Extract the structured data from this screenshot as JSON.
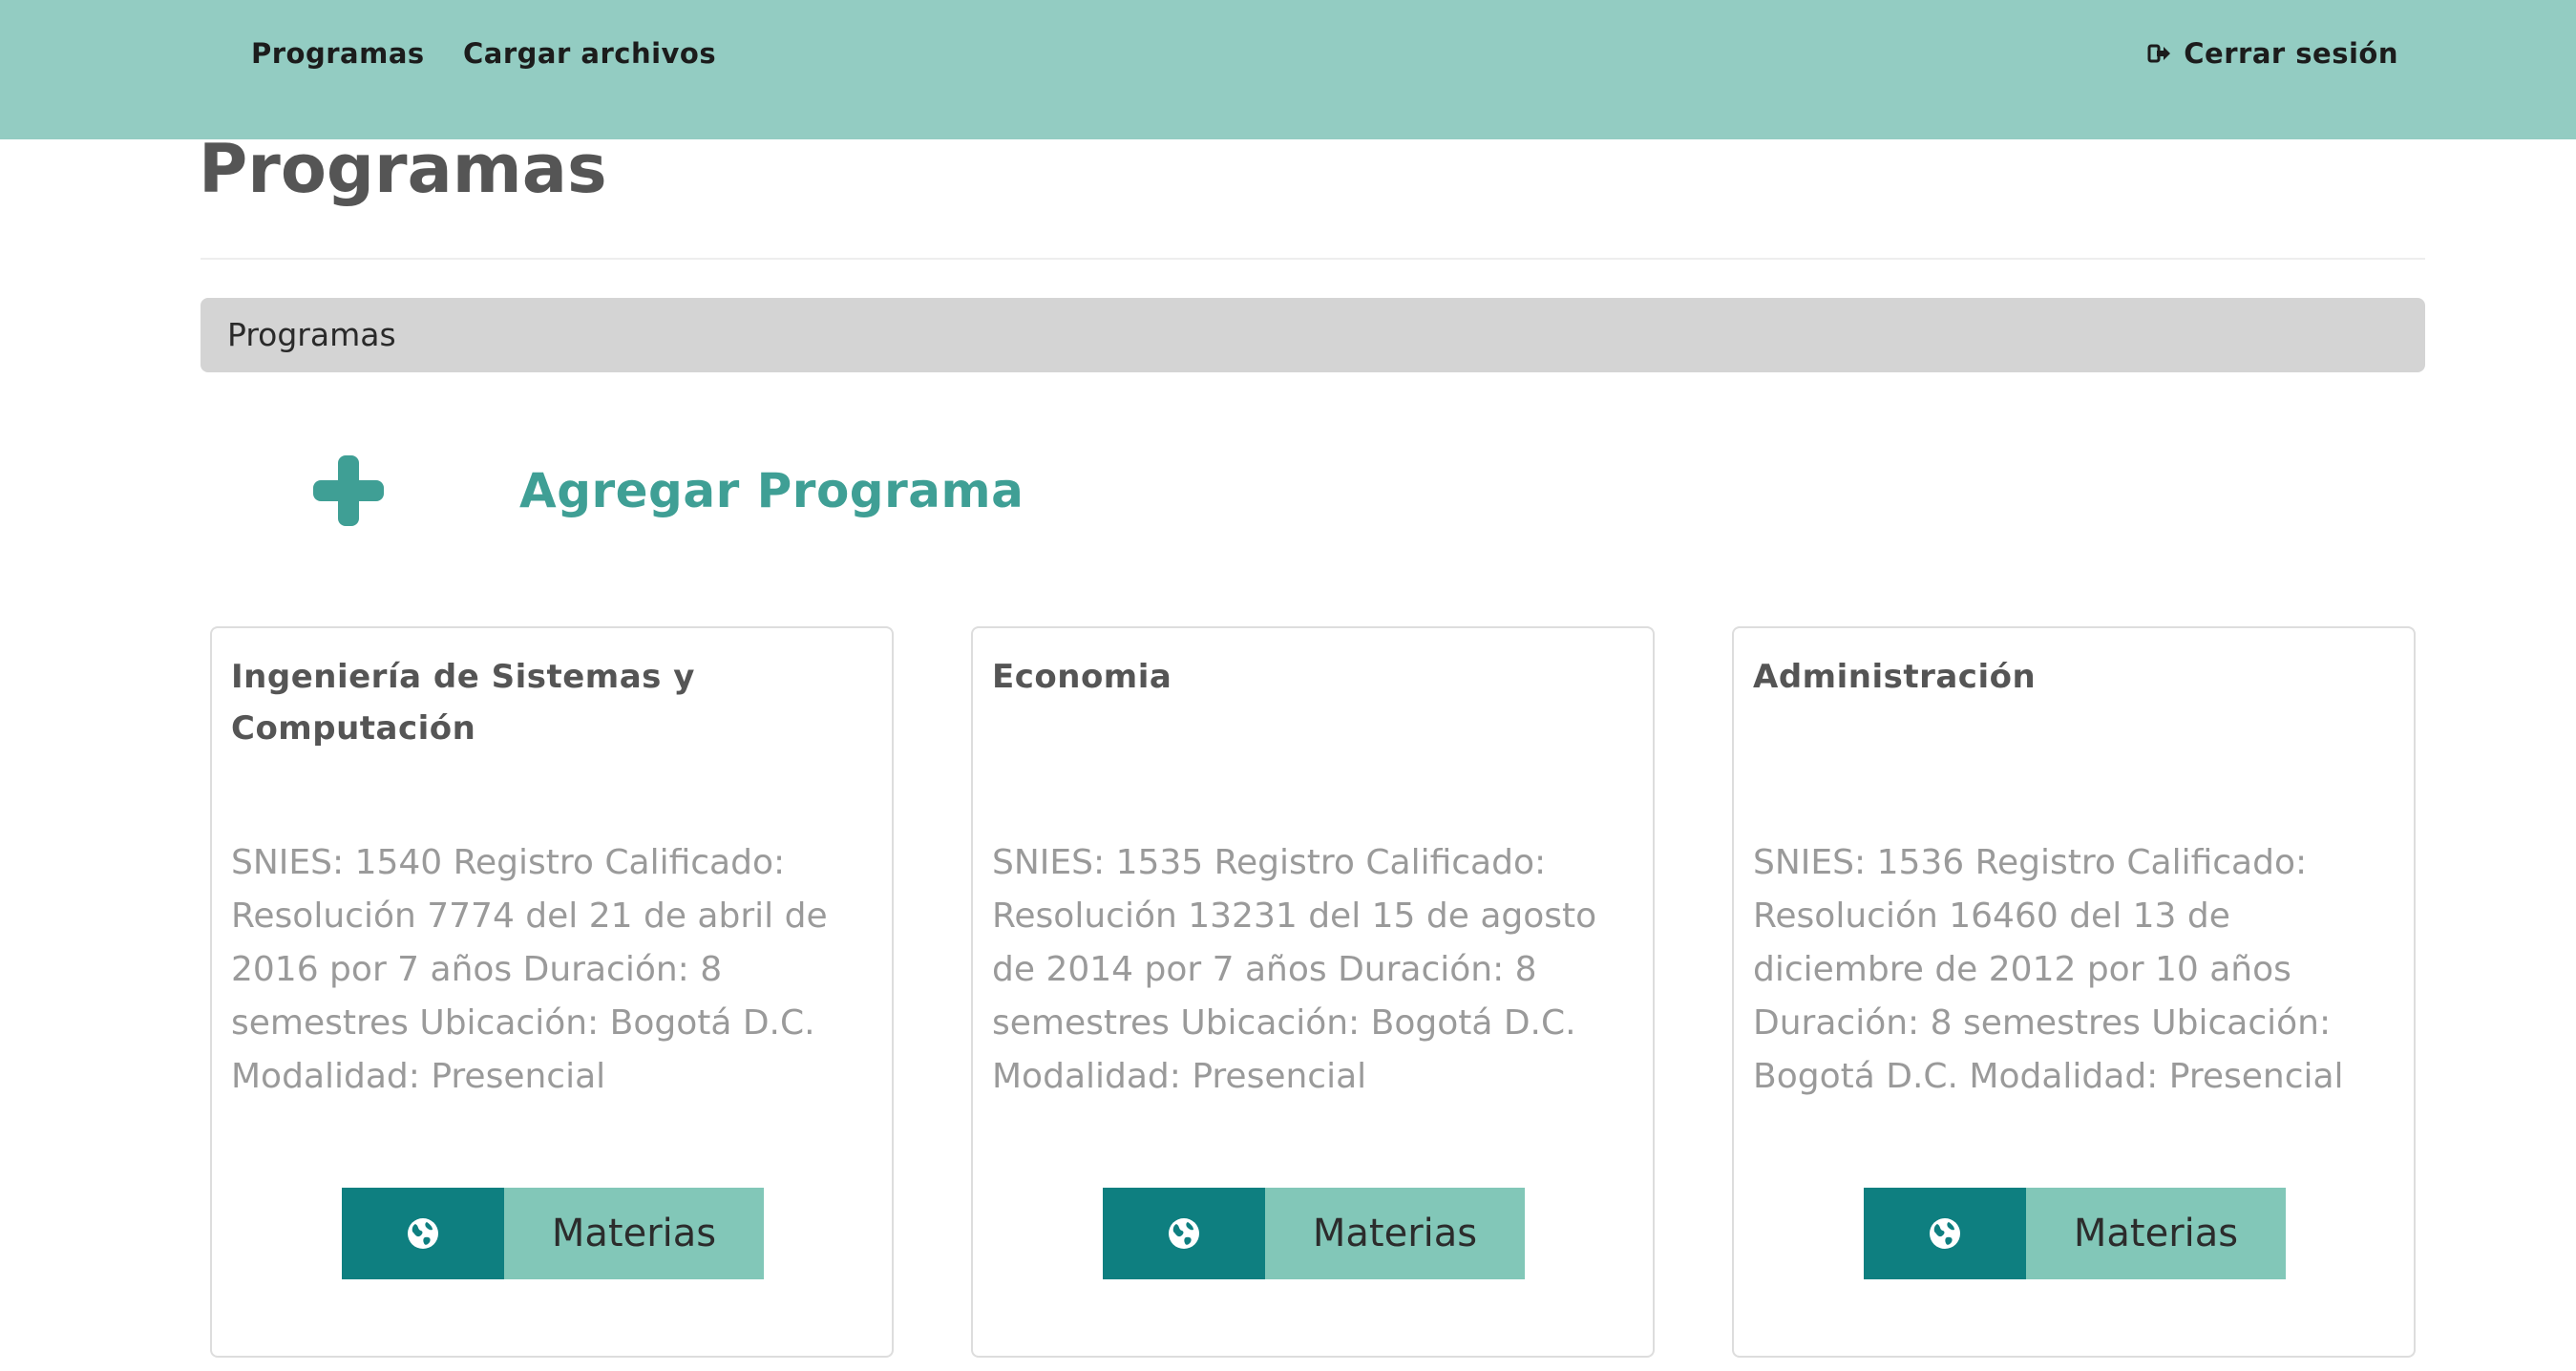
{
  "navbar": {
    "programs_label": "Programas",
    "upload_label": "Cargar archivos",
    "logout_label": "Cerrar sesión",
    "logout_icon": "sign-out-icon",
    "background": "#93ccc2"
  },
  "page": {
    "title": "Programas",
    "breadcrumb": "Programas"
  },
  "add_program": {
    "icon": "plus-icon",
    "label": "Agregar Programa",
    "color": "#3f9f95"
  },
  "programs": [
    {
      "title": "Ingeniería de Sistemas y Computación",
      "description": "SNIES: 1540 Registro Calificado: Resolución 7774 del 21 de abril de 2016 por 7 años Duración: 8 semestres Ubicación: Bogotá D.C. Modalidad: Presencial",
      "globe_icon": "globe-icon",
      "button_label": "Materias"
    },
    {
      "title": "Economia",
      "description": "SNIES: 1535 Registro Calificado: Resolución 13231 del 15 de agosto de 2014 por 7 años Duración: 8 semestres Ubicación: Bogotá D.C. Modalidad: Presencial",
      "globe_icon": "globe-icon",
      "button_label": "Materias"
    },
    {
      "title": "Administración",
      "description": "SNIES: 1536 Registro Calificado: Resolución 16460 del 13 de diciembre de 2012 por 10 años Duración: 8 semestres Ubicación: Bogotá D.C. Modalidad: Presencial",
      "globe_icon": "globe-icon",
      "button_label": "Materias"
    }
  ],
  "colors": {
    "globe_button": "#0e7f80",
    "materias_button": "#82c7b8"
  }
}
